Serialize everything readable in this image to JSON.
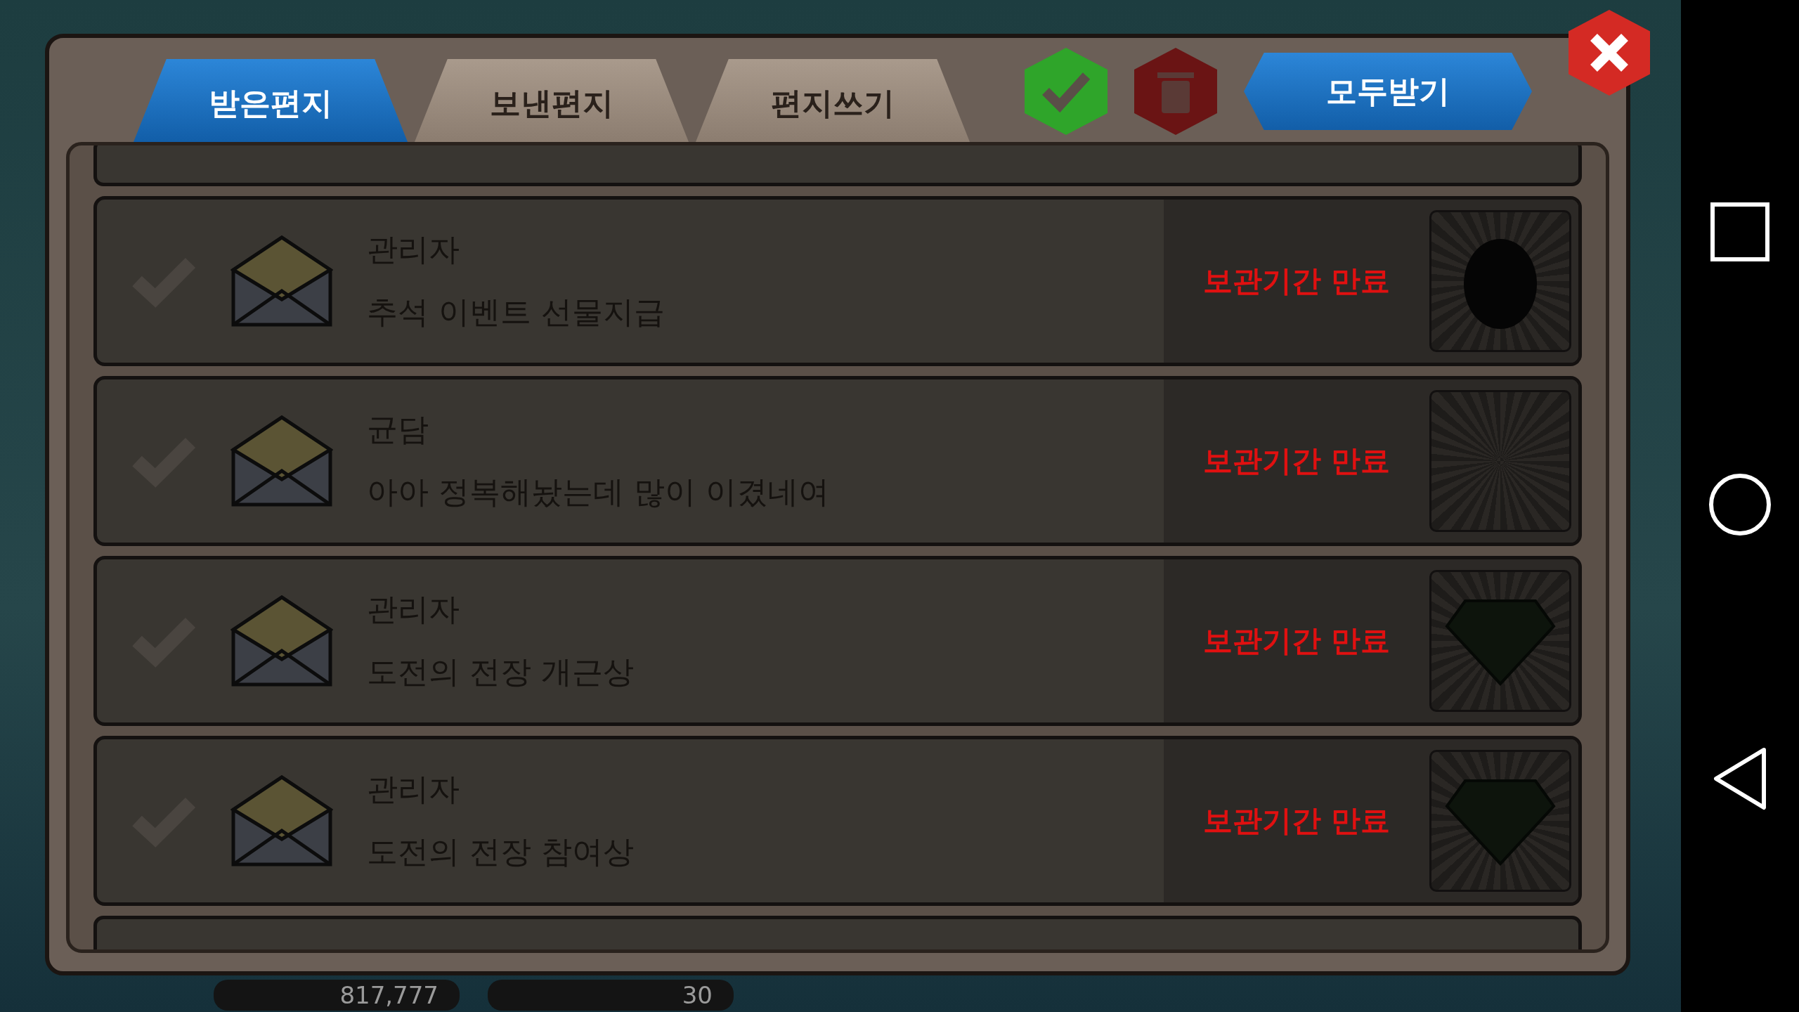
{
  "tabs": [
    {
      "label": "받은편지",
      "selected": true
    },
    {
      "label": "보낸편지",
      "selected": false
    },
    {
      "label": "편지쓰기",
      "selected": false
    }
  ],
  "toolbar": {
    "receive_all": "모두받기"
  },
  "mails": [
    {
      "sender": "관리자",
      "subject": "추석 이벤트 선물지급",
      "status": "보관기간 만료",
      "kind": "egg"
    },
    {
      "sender": "균담",
      "subject": "아아 정복해놨는데 많이 이겼네여",
      "status": "보관기간 만료",
      "kind": "empty"
    },
    {
      "sender": "관리자",
      "subject": "도전의 전장 개근상",
      "status": "보관기간 만료",
      "kind": "gem"
    },
    {
      "sender": "관리자",
      "subject": "도전의 전장 참여상",
      "status": "보관기간 만료",
      "kind": "gem"
    }
  ],
  "currency": {
    "coins": "817,777",
    "gems": "30"
  }
}
